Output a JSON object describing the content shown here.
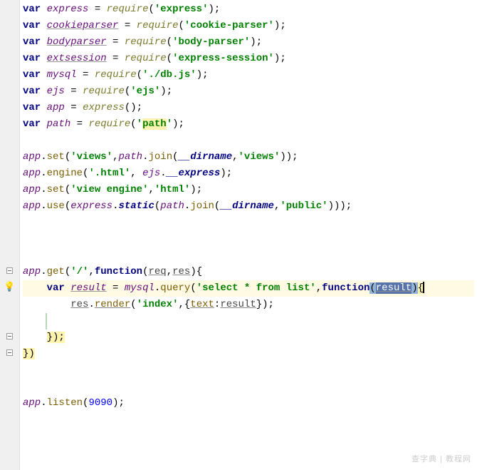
{
  "chart_data": null,
  "code": {
    "l1": {
      "var": "var",
      "name": "express",
      "eq": " = ",
      "fn": "require",
      "s": "'express'",
      "end": ";"
    },
    "l2": {
      "var": "var",
      "name": "cookieparser",
      "eq": " = ",
      "fn": "require",
      "s": "'cookie-parser'",
      "end": ";"
    },
    "l3": {
      "var": "var",
      "name": "bodyparser",
      "eq": " = ",
      "fn": "require",
      "s": "'body-parser'",
      "end": ";"
    },
    "l4": {
      "var": "var",
      "name": "extsession",
      "eq": " = ",
      "fn": "require",
      "s": "'express-session'",
      "end": ";"
    },
    "l5": {
      "var": "var",
      "name": "mysql",
      "eq": " = ",
      "fn": "require",
      "s": "'./db.js'",
      "end": ";"
    },
    "l6": {
      "var": "var",
      "name": "ejs",
      "eq": " = ",
      "fn": "require",
      "s": "'ejs'",
      "end": ";"
    },
    "l7": {
      "var": "var",
      "name": "app",
      "eq": " = ",
      "fn": "express",
      "end": "();"
    },
    "l8": {
      "var": "var",
      "name": "path",
      "eq": " = ",
      "fn": "require",
      "pre": "'",
      "hl": "path",
      "post": "'",
      "end": ";"
    },
    "l10": {
      "obj": "app",
      "dot": ".",
      "m": "set",
      "s1": "'views'",
      "c": ",",
      "obj2": "path",
      "dot2": ".",
      "m2": "join",
      "p1": "__dirname",
      "c2": ",",
      "s2": "'views'",
      "end": ";"
    },
    "l11": {
      "obj": "app",
      "dot": ".",
      "m": "engine",
      "s1": "'.html'",
      "c": ", ",
      "obj2": "ejs",
      "dot2": ".",
      "p": "__express",
      "end": ";"
    },
    "l12": {
      "obj": "app",
      "dot": ".",
      "m": "set",
      "s1": "'view engine'",
      "c": ",",
      "s2": "'html'",
      "end": ";"
    },
    "l13": {
      "obj": "app",
      "dot": ".",
      "m": "use",
      "obj2": "express",
      "dot2": ".",
      "m2": "static",
      "obj3": "path",
      "dot3": ".",
      "m3": "join",
      "p1": "__dirname",
      "c": ",",
      "s": "'public'",
      "end": ";"
    },
    "l17": {
      "obj": "app",
      "dot": ".",
      "m": "get",
      "s": "'/'",
      "c": ",",
      "kw": "function",
      "p1": "req",
      "c2": ",",
      "p2": "res",
      "brace": "{"
    },
    "l18": {
      "pad": "    ",
      "var": "var",
      "name": "result",
      "eq": " = ",
      "obj": "mysql",
      "dot": ".",
      "m": "query",
      "s": "'select * from list'",
      "c": ",",
      "kw": "function",
      "p": "result",
      "brace": "{"
    },
    "l19": {
      "pad": "        ",
      "obj": "res",
      "dot": ".",
      "m": "render",
      "s": "'index'",
      "c": ",",
      "brace": "{",
      "key": "text",
      "colon": ":",
      "val": "result",
      "end": "});"
    },
    "l21": {
      "pad": "    ",
      "end": "});"
    },
    "l22": {
      "end": "})"
    },
    "l25": {
      "obj": "app",
      "dot": ".",
      "m": "listen",
      "num": "9090",
      "end": ";"
    }
  },
  "watermark": "查字典 | 教程网"
}
